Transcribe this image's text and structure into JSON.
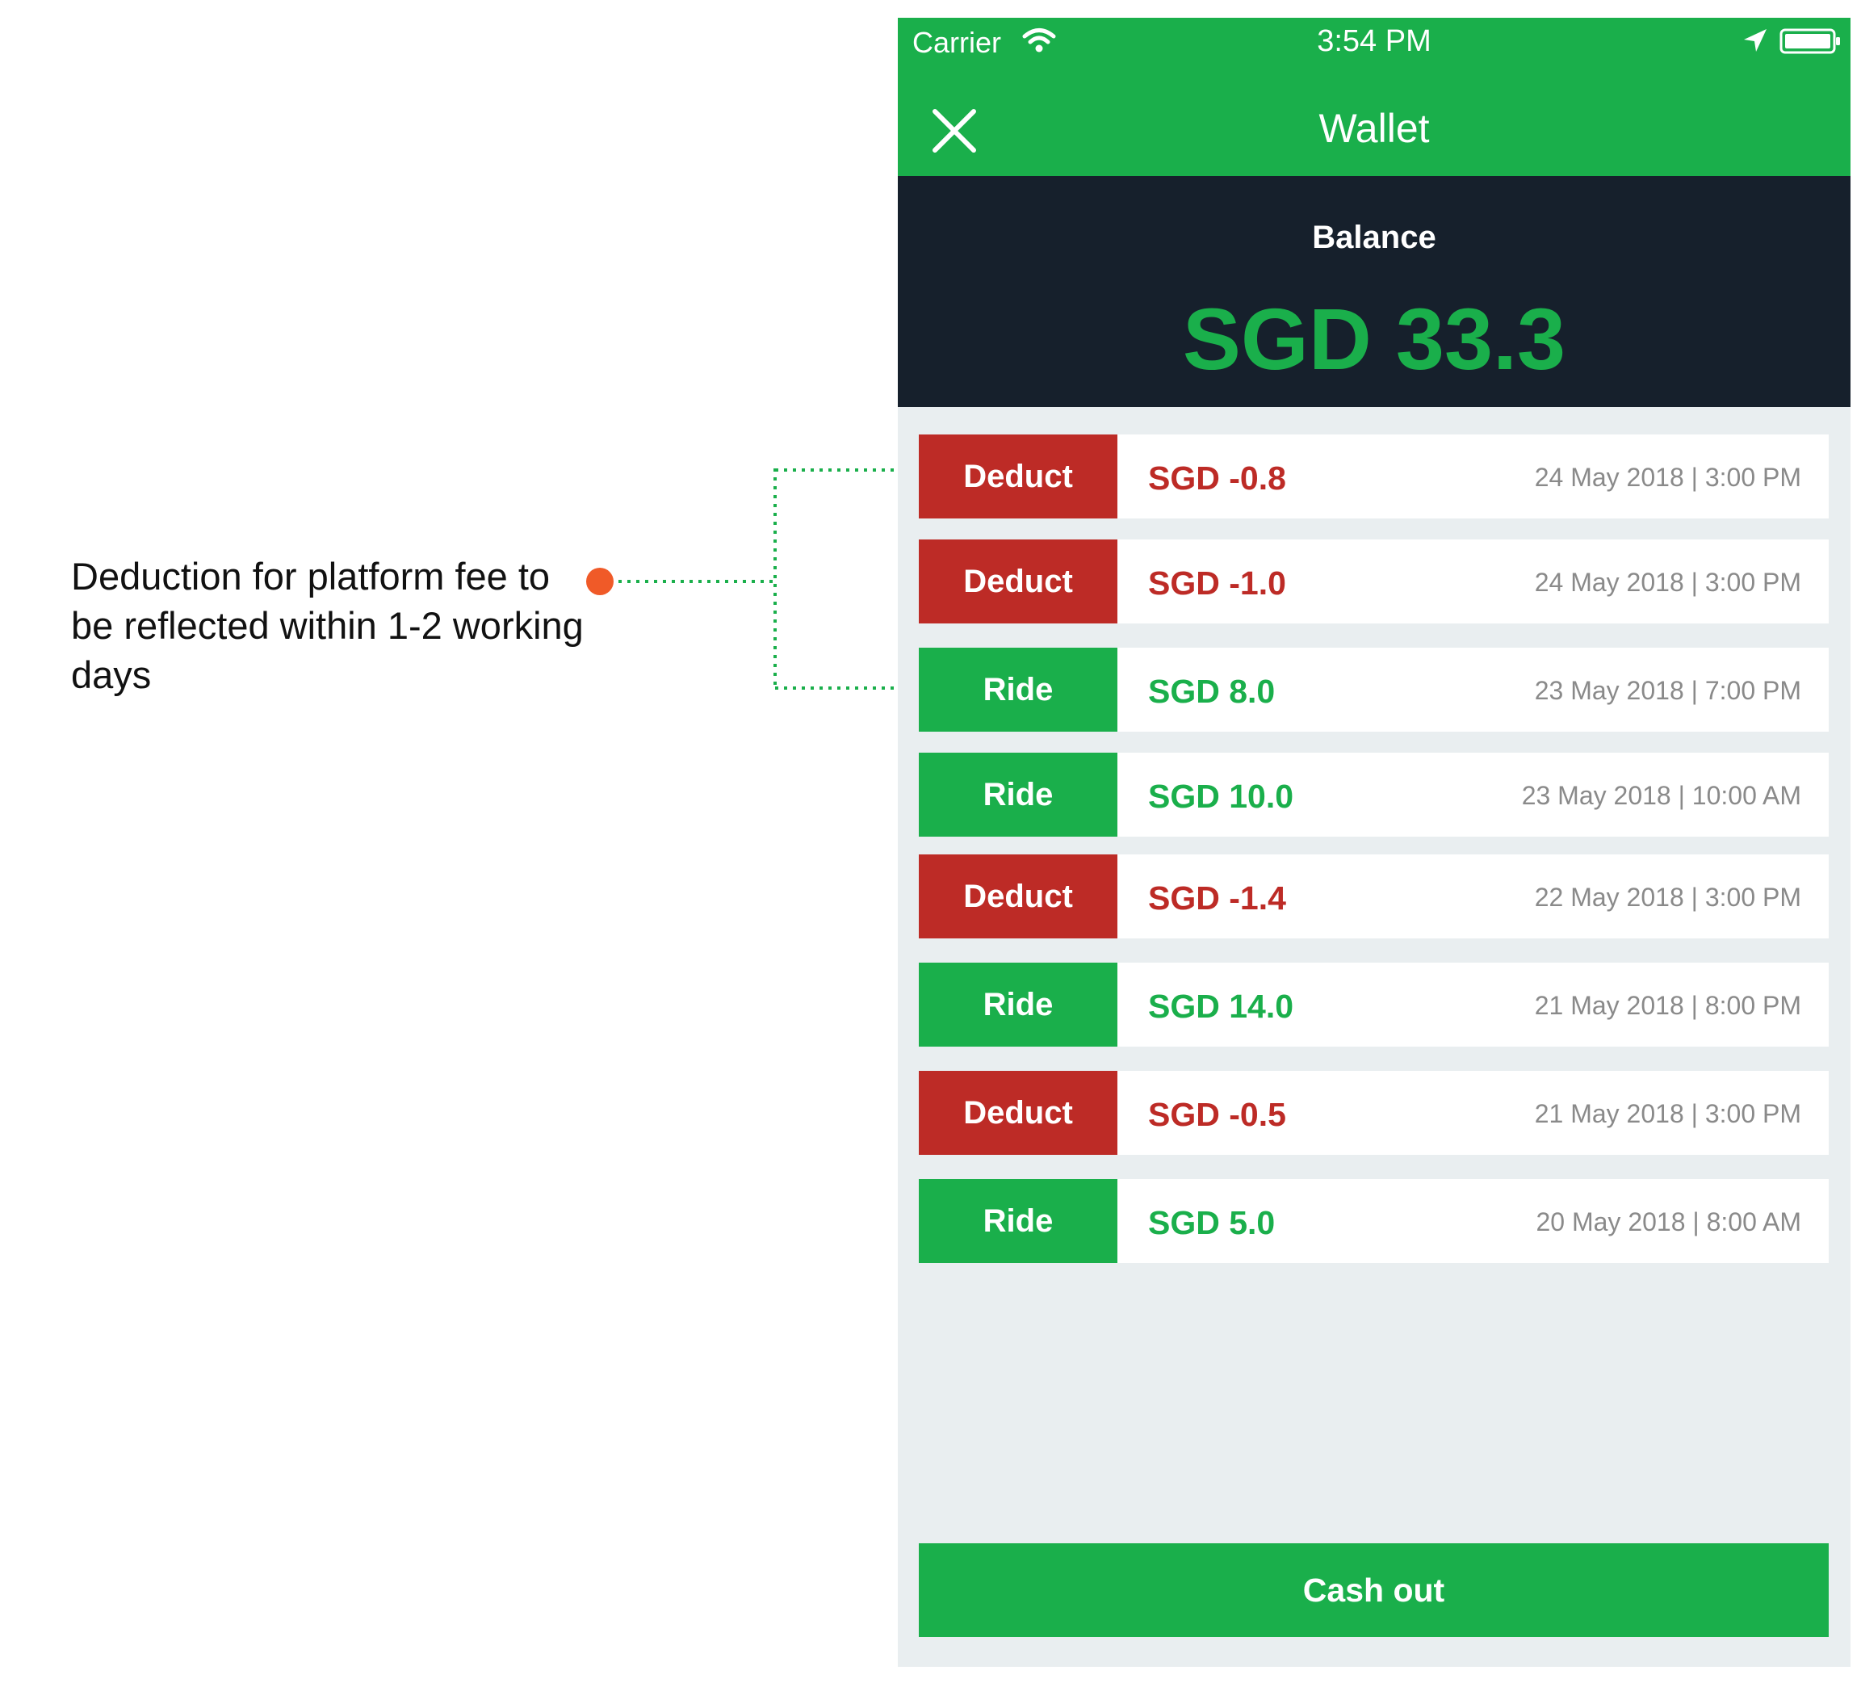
{
  "colors": {
    "green": "#1aaf4b",
    "red": "#bd2b26",
    "dark_panel": "#16202c",
    "background": "#e9eef0",
    "date_gray": "#8a8a8a",
    "annotation_dot": "#f05a28",
    "connector": "#1aaf4b"
  },
  "annotation": {
    "text": "Deduction for platform fee to be reflected within 1-2 working days"
  },
  "status_bar": {
    "carrier": "Carrier",
    "time": "3:54 PM",
    "icons": [
      "wifi-icon",
      "location-arrow-icon",
      "battery-icon"
    ]
  },
  "nav": {
    "title": "Wallet",
    "close_icon": "close-icon"
  },
  "balance": {
    "label": "Balance",
    "amount": "SGD 33.3"
  },
  "transactions": [
    {
      "type": "Deduct",
      "amount": "SGD -0.8",
      "date": "24 May 2018 | 3:00 PM",
      "kind": "deduct"
    },
    {
      "type": "Deduct",
      "amount": "SGD -1.0",
      "date": "24 May 2018 | 3:00 PM",
      "kind": "deduct"
    },
    {
      "type": "Ride",
      "amount": "SGD 8.0",
      "date": "23 May 2018 | 7:00 PM",
      "kind": "ride"
    },
    {
      "type": "Ride",
      "amount": "SGD 10.0",
      "date": "23 May 2018 | 10:00 AM",
      "kind": "ride"
    },
    {
      "type": "Deduct",
      "amount": "SGD -1.4",
      "date": "22 May 2018 | 3:00 PM",
      "kind": "deduct"
    },
    {
      "type": "Ride",
      "amount": "SGD 14.0",
      "date": "21 May 2018 | 8:00 PM",
      "kind": "ride"
    },
    {
      "type": "Deduct",
      "amount": "SGD -0.5",
      "date": "21 May 2018 | 3:00 PM",
      "kind": "deduct"
    },
    {
      "type": "Ride",
      "amount": "SGD 5.0",
      "date": "20 May 2018 | 8:00 AM",
      "kind": "ride"
    }
  ],
  "cashout": {
    "label": "Cash out"
  }
}
